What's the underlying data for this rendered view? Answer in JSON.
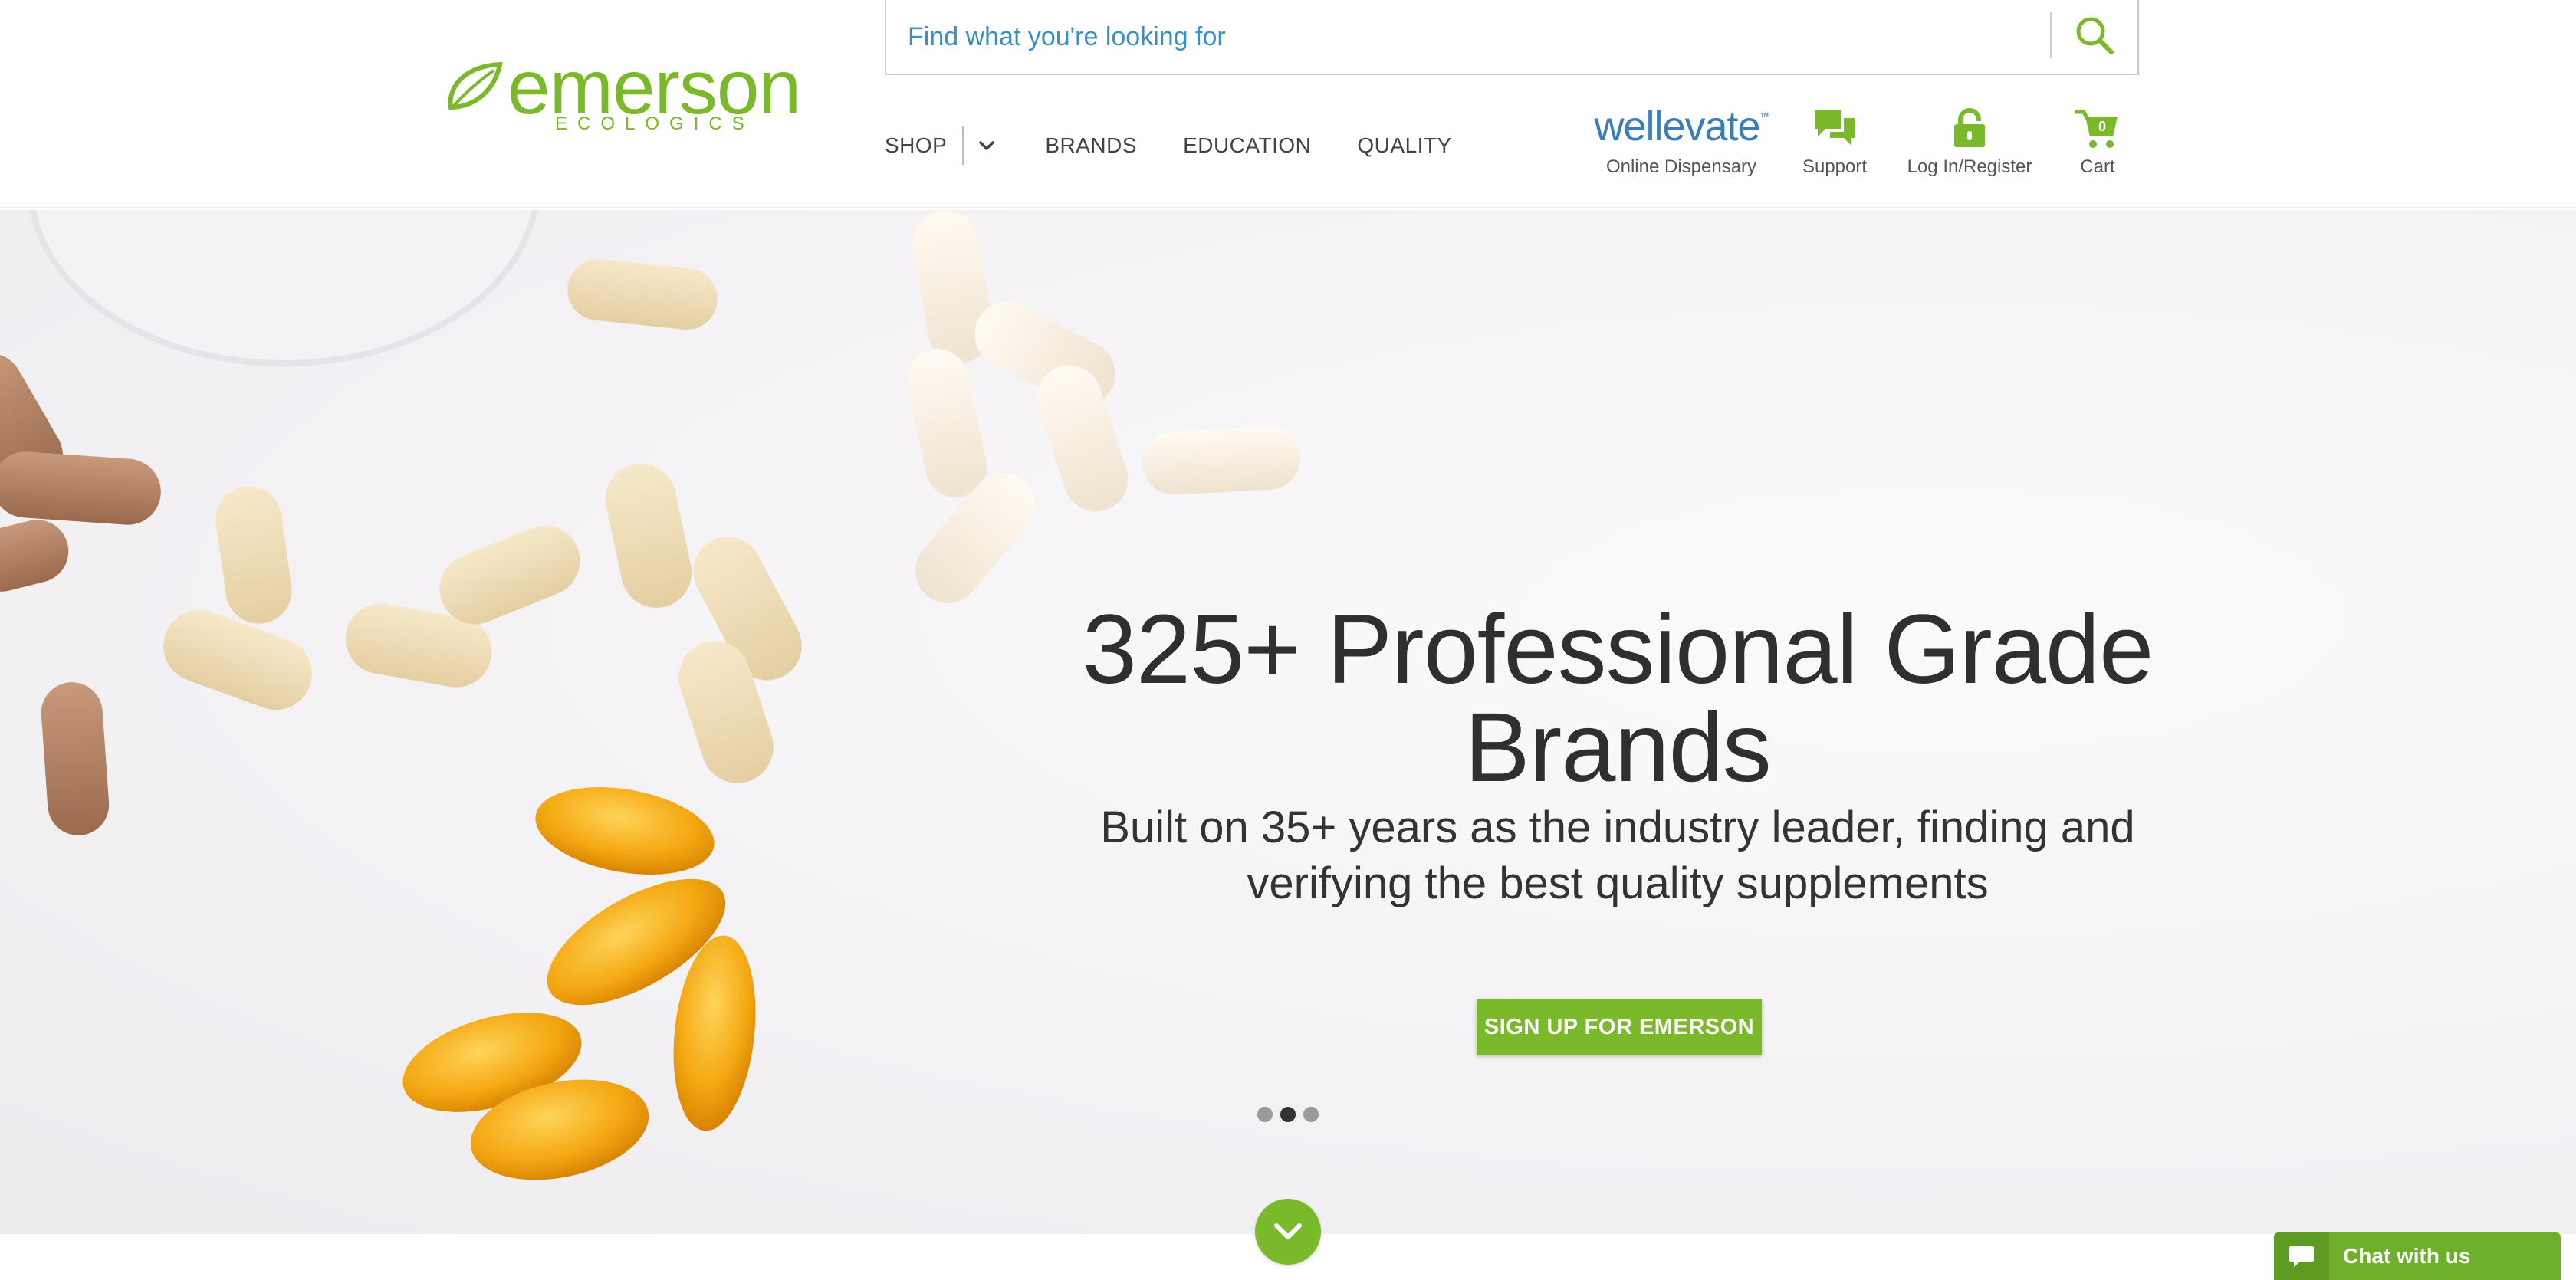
{
  "logo": {
    "word": "emerson",
    "sub": "ECOLOGICS"
  },
  "search": {
    "placeholder": "Find what you're looking for",
    "value": "",
    "button_icon": "search-icon"
  },
  "nav": {
    "shop": "SHOP",
    "brands": "BRANDS",
    "education": "EDUCATION",
    "quality": "QUALITY"
  },
  "utility": {
    "wellevate_logo": "wellevate",
    "wellevate_label": "Online Dispensary",
    "support_label": "Support",
    "login_label": "Log In/Register",
    "cart_label": "Cart",
    "cart_count": "0"
  },
  "hero": {
    "title": "325+ Professional Grade Brands",
    "subtitle": "Built on 35+ years as the industry leader, finding and verifying the best quality supplements",
    "cta": "SIGN UP FOR EMERSON",
    "slide_count": 3,
    "active_slide": 2
  },
  "chat": {
    "label": "Chat with us"
  },
  "colors": {
    "brand_green": "#7ab929",
    "link_blue": "#3b8fc4",
    "wellevate_blue": "#3a7dbf"
  }
}
